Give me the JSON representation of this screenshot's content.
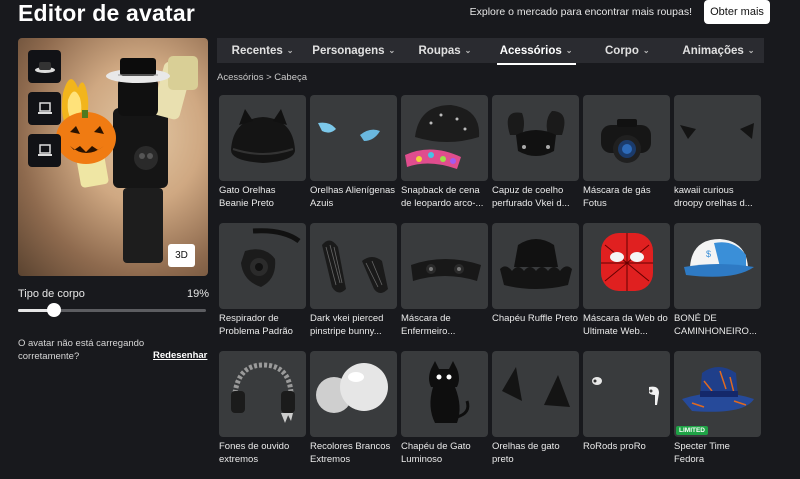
{
  "header": {
    "title": "Editor de avatar",
    "promo_text": "Explore o mercado para encontrar mais roupas!",
    "promo_button": "Obter mais"
  },
  "avatar_panel": {
    "slot_icons": [
      "hat-thumbnail-icon",
      "laptop-icon",
      "laptop-icon"
    ],
    "view_button": "3D",
    "body_type_label": "Tipo de corpo",
    "body_type_value": "19%",
    "body_type_level": 0.19,
    "warning_text": "O avatar não está carregando corretamente?",
    "redraw_link": "Redesenhar"
  },
  "tabs": [
    {
      "label": "Recentes",
      "active": false
    },
    {
      "label": "Personagens",
      "active": false
    },
    {
      "label": "Roupas",
      "active": false
    },
    {
      "label": "Acessórios",
      "active": true
    },
    {
      "label": "Corpo",
      "active": false
    },
    {
      "label": "Animações",
      "active": false
    }
  ],
  "breadcrumb": "Acessórios > Cabeça",
  "items": [
    {
      "name": "Gato Orelhas Beanie Preto",
      "icon": "cat-ear-beanie-icon"
    },
    {
      "name": "Orelhas Alienígenas Azuis",
      "icon": "alien-ears-icon"
    },
    {
      "name": "Snapback de cena de leopardo arco-...",
      "icon": "snapback-cap-icon"
    },
    {
      "name": "Capuz de coelho perfurado Vkei d...",
      "icon": "bunny-hood-icon"
    },
    {
      "name": "Máscara de gás Fotus",
      "icon": "gas-mask-icon"
    },
    {
      "name": "kawaii curious droopy orelhas d...",
      "icon": "droopy-ears-icon"
    },
    {
      "name": "Respirador de Problema Padrão",
      "icon": "respirator-icon"
    },
    {
      "name": "Dark vkei pierced pinstripe bunny...",
      "icon": "bunny-ears-icon"
    },
    {
      "name": "Máscara de Enfermeiro...",
      "icon": "nurse-mask-icon"
    },
    {
      "name": "Chapéu Ruffle Preto",
      "icon": "ruffle-hat-icon"
    },
    {
      "name": "Máscara da Web do Ultimate Web...",
      "icon": "spider-mask-icon"
    },
    {
      "name": "BONÉ DE CAMINHONEIRO...",
      "icon": "trucker-cap-icon"
    },
    {
      "name": "Fones de ouvido extremos",
      "icon": "headphones-icon"
    },
    {
      "name": "Recolores Brancos Extremos",
      "icon": "white-spheres-icon"
    },
    {
      "name": "Chapéu de Gato Luminoso",
      "icon": "glowing-cat-icon"
    },
    {
      "name": "Orelhas de gato preto",
      "icon": "black-cat-ears-icon"
    },
    {
      "name": "RoRods proRo",
      "icon": "earbuds-icon"
    },
    {
      "name": "Specter Time Fedora",
      "icon": "fedora-icon",
      "badge": "LIMITED"
    }
  ],
  "colors": {
    "background": "#18191d",
    "card": "#393b3d",
    "tab_bar": "#2a2b30",
    "limited_badge": "#1fa346"
  }
}
